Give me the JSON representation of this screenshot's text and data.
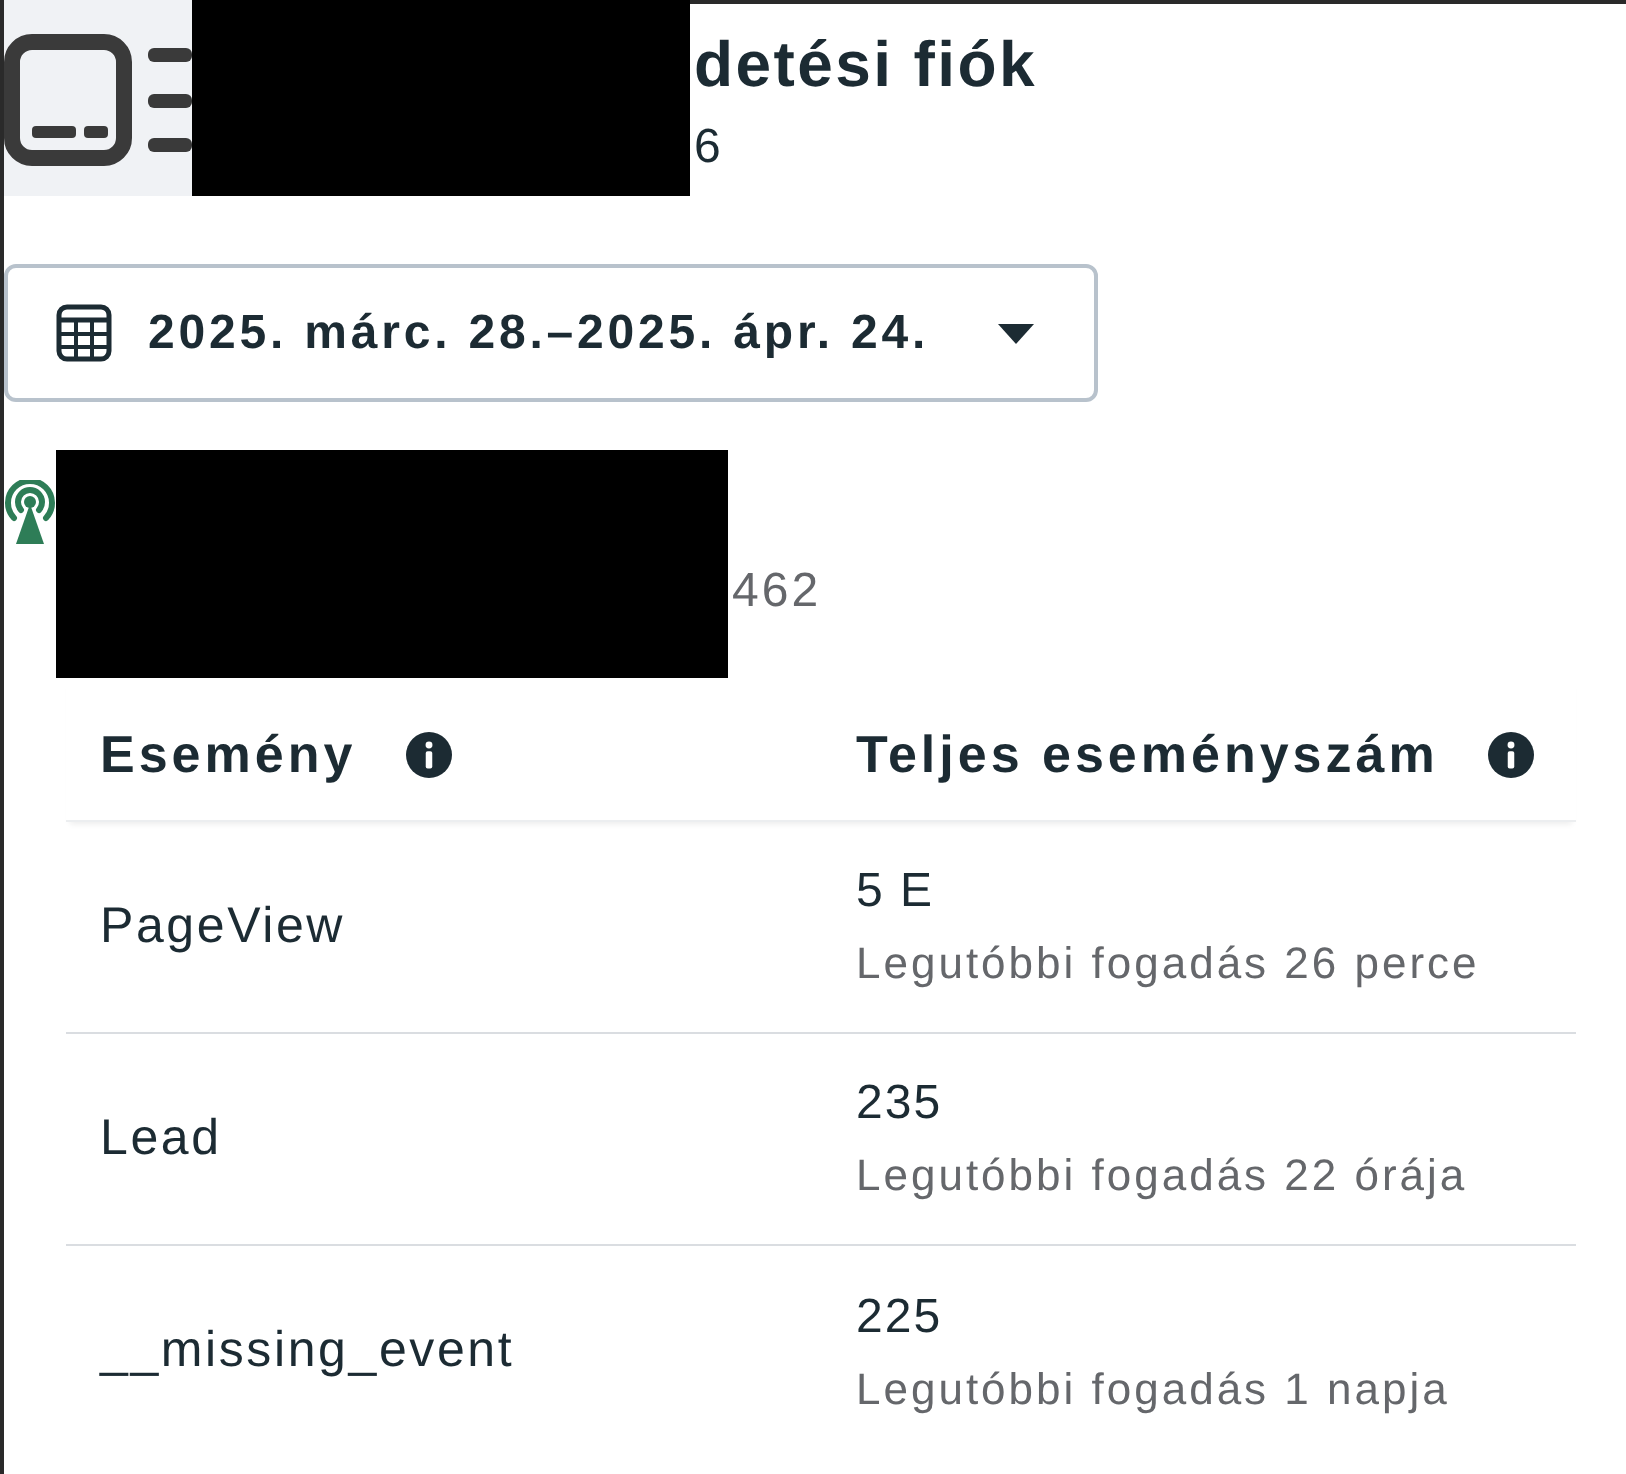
{
  "account": {
    "title": "detési fiók",
    "id": "6"
  },
  "date_range": {
    "label": "2025. márc. 28.–2025. ápr. 24."
  },
  "pixel": {
    "id": "462"
  },
  "table": {
    "columns": [
      {
        "label": "Esemény"
      },
      {
        "label": "Teljes eseményszám"
      }
    ],
    "rows": [
      {
        "event": "PageView",
        "count": "5 E",
        "last_received": "Legutóbbi fogadás 26 perce"
      },
      {
        "event": "Lead",
        "count": "235",
        "last_received": "Legutóbbi fogadás 22 órája"
      },
      {
        "event": "__missing_event",
        "count": "225",
        "last_received": "Legutóbbi fogadás 1 napja"
      }
    ]
  }
}
